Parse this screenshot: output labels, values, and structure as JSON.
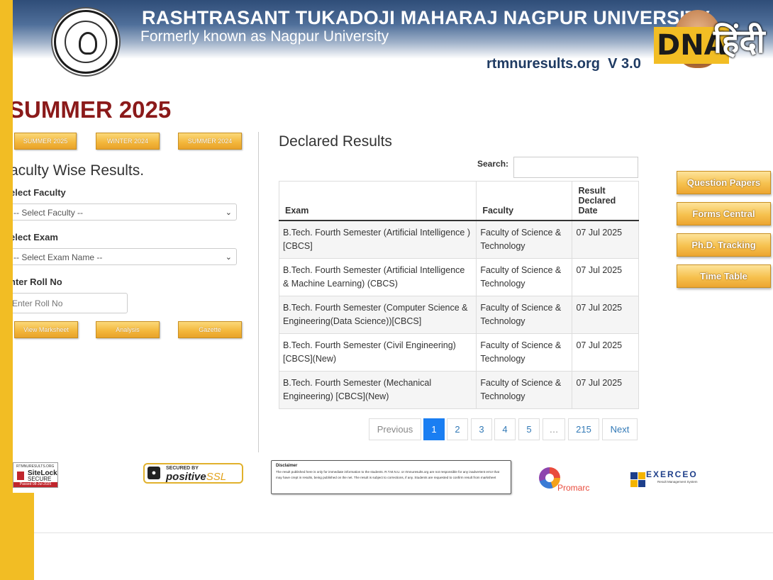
{
  "header": {
    "university_name": "RASHTRASANT TUKADOJI MAHARAJ NAGPUR UNIVERSITY",
    "subtitle": "Formerly known as Nagpur University",
    "site": "rtmnuresults.org",
    "version": "V 3.0",
    "overlay_logo": {
      "dna": "DNA",
      "hindi": "हिंदी"
    }
  },
  "session_title": "SUMMER 2025",
  "session_buttons": [
    "SUMMER 2025",
    "WINTER 2024",
    "SUMMER 2024"
  ],
  "faculty_form": {
    "heading": "aculty Wise Results.",
    "faculty_label": "elect Faculty",
    "faculty_value": "-- Select Faculty --",
    "exam_label": "elect Exam",
    "exam_value": "-- Select Exam Name --",
    "roll_label": "nter Roll No",
    "roll_placeholder": "Enter Roll No",
    "actions": [
      "View Marksheet",
      "Analysis",
      "Gazette"
    ]
  },
  "results": {
    "title": "Declared Results",
    "search_label": "Search:",
    "columns": [
      "Exam",
      "Faculty",
      "Result Declared Date"
    ],
    "rows": [
      {
        "exam": "B.Tech. Fourth Semester (Artificial Intelligence ) [CBCS]",
        "faculty": "Faculty of Science & Technology",
        "date": "07 Jul 2025"
      },
      {
        "exam": "B.Tech. Fourth Semester (Artificial Intelligence & Machine Learning) (CBCS)",
        "faculty": "Faculty of Science & Technology",
        "date": "07 Jul 2025"
      },
      {
        "exam": "B.Tech. Fourth Semester (Computer Science & Engineering(Data Science))[CBCS]",
        "faculty": "Faculty of Science & Technology",
        "date": "07 Jul 2025"
      },
      {
        "exam": "B.Tech. Fourth Semester (Civil Engineering) [CBCS](New)",
        "faculty": "Faculty of Science & Technology",
        "date": "07 Jul 2025"
      },
      {
        "exam": "B.Tech. Fourth Semester (Mechanical Engineering) [CBCS](New)",
        "faculty": "Faculty of Science & Technology",
        "date": "07 Jul 2025"
      }
    ],
    "pagination": {
      "previous": "Previous",
      "pages": [
        "1",
        "2",
        "3",
        "4",
        "5",
        "…",
        "215"
      ],
      "active": "1",
      "next": "Next"
    }
  },
  "side_links": [
    "Question Papers",
    "Forms Central",
    "Ph.D. Tracking",
    "Time Table"
  ],
  "footer": {
    "sitelock": {
      "top": "RTMNURESULTS.ORG",
      "brand": "SiteLock",
      "secure": "SECURE",
      "passed": "Passed 08-Jul-2025"
    },
    "ssl": {
      "secured_by": "SECURED BY",
      "brand": "positive",
      "suffix": "SSL"
    },
    "disclaimer": {
      "title": "Disclaimer",
      "body": "The result published here is only for immediate information to the students. R.T.M.N.U. or rtmnuresults.org are not responsible for any inadvertent error that may have crept in results, being published on the net. The result is subject to corrections, if any. Students are requested to confirm result from marksheet"
    },
    "promarc": "Promarc",
    "exerceo": {
      "name": "EXERCEO",
      "tagline": "Result Management System"
    }
  },
  "colors": {
    "session_title": "#8b1a1a",
    "gold": "#f3b63a",
    "active_page": "#1a7ef2",
    "frame": "#f2bd24"
  }
}
